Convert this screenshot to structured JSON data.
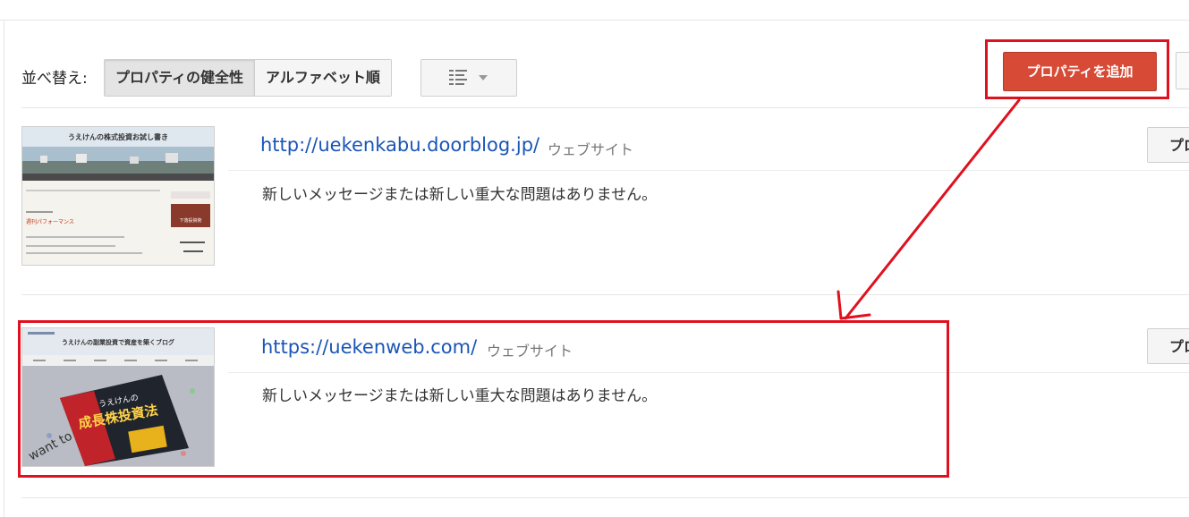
{
  "toolbar": {
    "sort_label": "並べ替え:",
    "sort_options": [
      "プロパティの健全性",
      "アルファベット順"
    ],
    "view_icon": "list-view-icon",
    "add_property_label": "プロパティを追加"
  },
  "properties": [
    {
      "url": "http://uekenkabu.doorblog.jp/",
      "type": "ウェブサイト",
      "message": "新しいメッセージまたは新しい重大な問題はありません。",
      "side_button": "プロ",
      "thumbnail": {
        "blog_title": "うえけんの株式投資お試し書き",
        "section_title": "週刊パフォーマンス",
        "banner": "下落投資術"
      }
    },
    {
      "url": "https://uekenweb.com/",
      "type": "ウェブサイト",
      "message": "新しいメッセージまたは新しい重大な問題はありません。",
      "side_button": "プロ",
      "thumbnail": {
        "blog_title": "うえけんの副業投資で資産を築くブログ",
        "book_title": "成長株投資法",
        "book_sub": "うえけんの"
      }
    }
  ],
  "colors": {
    "add_button": "#d64a36",
    "highlight": "#e0111f",
    "link": "#1a55b7"
  }
}
